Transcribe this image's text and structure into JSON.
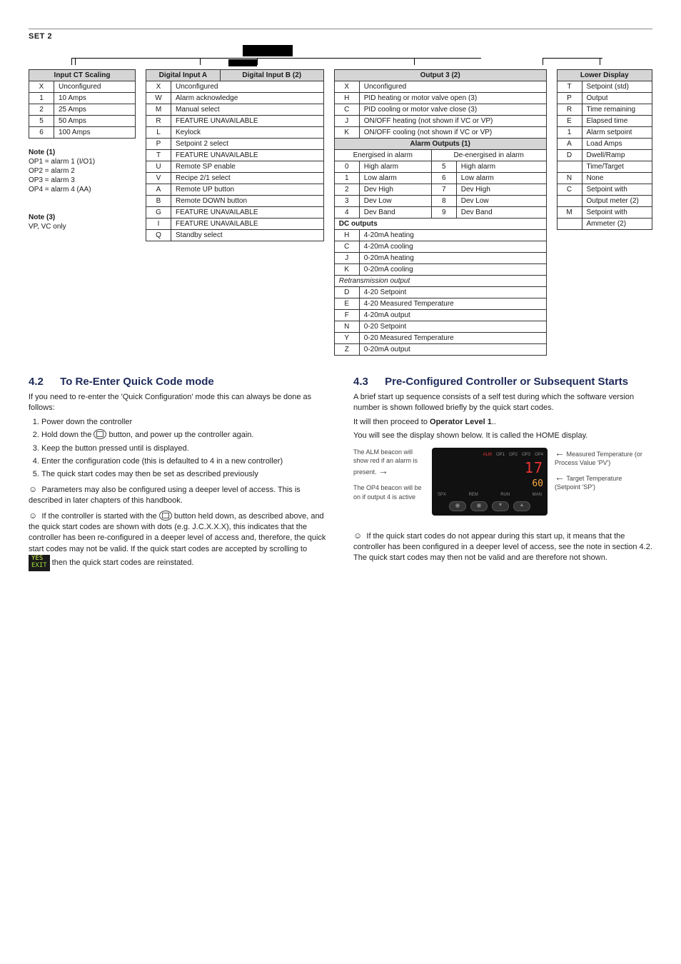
{
  "set_label": "SET 2",
  "tableCT": {
    "title": "Input CT Scaling",
    "rows": [
      {
        "code": "X",
        "label": "Unconfigured"
      },
      {
        "code": "1",
        "label": "10 Amps"
      },
      {
        "code": "2",
        "label": "25 Amps"
      },
      {
        "code": "5",
        "label": "50 Amps"
      },
      {
        "code": "6",
        "label": "100 Amps"
      }
    ]
  },
  "tableDigital": {
    "titleA": "Digital Input A",
    "titleB": "Digital Input B (2)",
    "rows": [
      {
        "code": "X",
        "label": "Unconfigured"
      },
      {
        "code": "W",
        "label": "Alarm acknowledge"
      },
      {
        "code": "M",
        "label": "Manual select"
      },
      {
        "code": "R",
        "label": "FEATURE UNAVAILABLE"
      },
      {
        "code": "L",
        "label": "Keylock"
      },
      {
        "code": "P",
        "label": "Setpoint 2 select"
      },
      {
        "code": "T",
        "label": "FEATURE UNAVAILABLE"
      },
      {
        "code": "U",
        "label": "Remote SP enable"
      },
      {
        "code": "V",
        "label": "Recipe 2/1 select"
      },
      {
        "code": "A",
        "label": "Remote UP button"
      },
      {
        "code": "B",
        "label": "Remote DOWN button"
      },
      {
        "code": "G",
        "label": "FEATURE UNAVAILABLE"
      },
      {
        "code": "I",
        "label": "FEATURE UNAVAILABLE"
      },
      {
        "code": "Q",
        "label": "Standby select"
      }
    ]
  },
  "tableOutput3": {
    "title": "Output 3 (2)",
    "rows": [
      {
        "code": "X",
        "label": "Unconfigured"
      },
      {
        "code": "H",
        "label": "PID heating or motor valve open (3)"
      },
      {
        "code": "C",
        "label": "PID cooling or motor valve close (3)"
      },
      {
        "code": "J",
        "label": "ON/OFF heating (not shown if VC or VP)"
      },
      {
        "code": "K",
        "label": "ON/OFF cooling (not shown if VC or VP)"
      }
    ],
    "alarm_title": "Alarm Outputs (1)",
    "alarm_left": "Energised in alarm",
    "alarm_right": "De-energised in alarm",
    "alarm_rows": [
      {
        "c1": "0",
        "l1": "High alarm",
        "c2": "5",
        "l2": "High alarm"
      },
      {
        "c1": "1",
        "l1": "Low alarm",
        "c2": "6",
        "l2": "Low alarm"
      },
      {
        "c1": "2",
        "l1": "Dev High",
        "c2": "7",
        "l2": "Dev High"
      },
      {
        "c1": "3",
        "l1": "Dev Low",
        "c2": "8",
        "l2": "Dev Low"
      },
      {
        "c1": "4",
        "l1": "Dev Band",
        "c2": "9",
        "l2": "Dev Band"
      }
    ],
    "dc_title": "DC outputs",
    "dc_rows": [
      {
        "code": "H",
        "label": "4-20mA heating"
      },
      {
        "code": "C",
        "label": "4-20mA cooling"
      },
      {
        "code": "J",
        "label": "0-20mA heating"
      },
      {
        "code": "K",
        "label": "0-20mA cooling"
      }
    ],
    "retrans_title": "Retransmission output",
    "retrans_rows": [
      {
        "code": "D",
        "label": "4-20 Setpoint"
      },
      {
        "code": "E",
        "label": "4-20 Measured Temperature"
      },
      {
        "code": "F",
        "label": "4-20mA output"
      },
      {
        "code": "N",
        "label": "0-20 Setpoint"
      },
      {
        "code": "Y",
        "label": "0-20 Measured Temperature"
      },
      {
        "code": "Z",
        "label": "0-20mA output"
      }
    ]
  },
  "tableLower": {
    "title": "Lower Display",
    "rows": [
      {
        "code": "T",
        "label": "Setpoint (std)"
      },
      {
        "code": "P",
        "label": "Output"
      },
      {
        "code": "R",
        "label": "Time remaining"
      },
      {
        "code": "E",
        "label": "Elapsed time"
      },
      {
        "code": "1",
        "label": "Alarm setpoint"
      },
      {
        "code": "A",
        "label": "Load Amps"
      },
      {
        "code": "D",
        "label": "Dwell/Ramp"
      },
      {
        "code": "",
        "label": "Time/Target"
      },
      {
        "code": "N",
        "label": "None"
      },
      {
        "code": "C",
        "label": "Setpoint with"
      },
      {
        "code": "",
        "label": "Output meter (2)"
      },
      {
        "code": "M",
        "label": "Setpoint with"
      },
      {
        "code": "",
        "label": "Ammeter (2)"
      }
    ]
  },
  "notes": {
    "n1_head": "Note (1)",
    "n1_lines": [
      "OP1 = alarm 1 (I/O1)",
      "OP2 = alarm 2",
      "OP3 = alarm 3",
      "OP4 = alarm 4  (AA)"
    ],
    "n3_head": "Note (3)",
    "n3_lines": [
      "VP, VC only"
    ]
  },
  "sec42": {
    "num": "4.2",
    "title": "To Re-Enter Quick Code mode",
    "intro": "If you need to re-enter the 'Quick Configuration' mode this can always be done as follows:",
    "steps": [
      "Power down the controller",
      "Hold down the  button, and power up the controller again.",
      "Keep the button pressed until   is displayed.",
      "Enter the configuration code (this is defaulted to 4 in a new controller)",
      "The quick start codes may then be set as described previously"
    ],
    "step2_pre": "Hold down the ",
    "step2_post": " button, and power up the controller again.",
    "para1": "Parameters may also be configured using a deeper level of access.  This is described in later chapters of this handbook.",
    "para2a": "If the controller is started with the ",
    "para2b": " button held down, as described above, and the quick start codes are shown with dots  (e.g.  J.C.X.X.X), this indicates that the controller has been re-configured in a deeper level of access and, therefore, the quick start codes may not be valid.  If the quick start codes are accepted by scrolling to ",
    "para2c": " then the quick start codes are reinstated.",
    "yes": "YES",
    "exit": "EXIT"
  },
  "sec43": {
    "num": "4.3",
    "title": "Pre-Configured Controller or Subsequent Starts",
    "p1": "A brief start up sequence consists of a self test during which the software version number is shown followed briefly by the quick start codes.",
    "p2a": "It will then proceed to ",
    "p2b": "Operator Level 1",
    "p2c": "..",
    "p3": "You will see the display shown below.  It is called the HOME display.",
    "ann_left1": "The ALM beacon will show red if an alarm is present.",
    "ann_left2": "The OP4 beacon will be on if output 4 is active",
    "ann_right1": "Measured Temperature (or Process Value 'PV')",
    "ann_right2": "Target Temperature (Setpoint 'SP')",
    "dev": {
      "leds": [
        "ALM",
        "OP1",
        "OP2",
        "OP3",
        "OP4"
      ],
      "pv": "17",
      "sp": "60",
      "modes": [
        "SPX",
        "REM",
        "RUN",
        "MAN"
      ]
    },
    "p4": "If the quick start codes do not appear during this start up, it means that the controller has been configured in a deeper level of access, see the note in section 4.2.   The quick start codes may then not be valid and are therefore not shown."
  }
}
